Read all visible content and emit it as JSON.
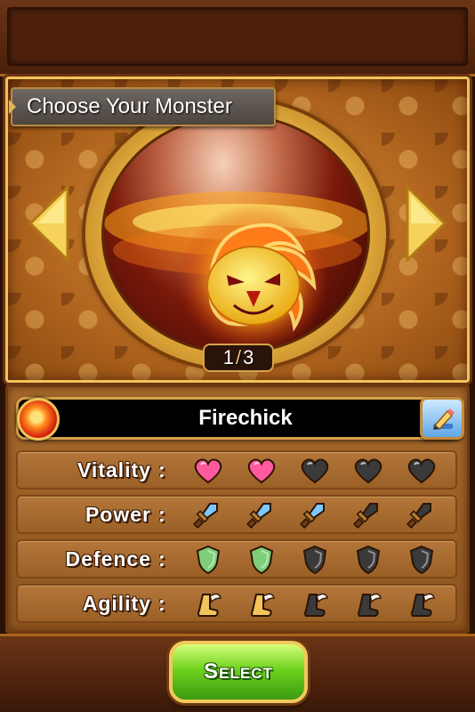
{
  "screen": {
    "title": "Choose Your Monster",
    "counter": {
      "current": "1",
      "separator": "/",
      "total": "3"
    }
  },
  "monster": {
    "name": "Firechick",
    "element": "fire",
    "portrait": "firechick-flaming-bird"
  },
  "stats": [
    {
      "label": "Vitality",
      "colon": ":",
      "icon": "heart-icon",
      "value": 2,
      "max": 5
    },
    {
      "label": "Power",
      "colon": ":",
      "icon": "sword-icon",
      "value": 3,
      "max": 5
    },
    {
      "label": "Defence",
      "colon": ":",
      "icon": "shield-icon",
      "value": 2,
      "max": 5
    },
    {
      "label": "Agility",
      "colon": ":",
      "icon": "winged-boot-icon",
      "value": 2,
      "max": 5
    }
  ],
  "buttons": {
    "select_label": "Select",
    "edit_icon": "pencil-icon",
    "prev_icon": "arrow-left-icon",
    "next_icon": "arrow-right-icon"
  },
  "colors": {
    "accent_gold": "#f1c35a",
    "select_green": "#6fd21e",
    "heart_active": "#ff5a9e",
    "sword_active": "#7cc8ff",
    "shield_active": "#7fcf7a",
    "boot_active": "#f3c45a",
    "inactive": "#3a3a3a"
  }
}
